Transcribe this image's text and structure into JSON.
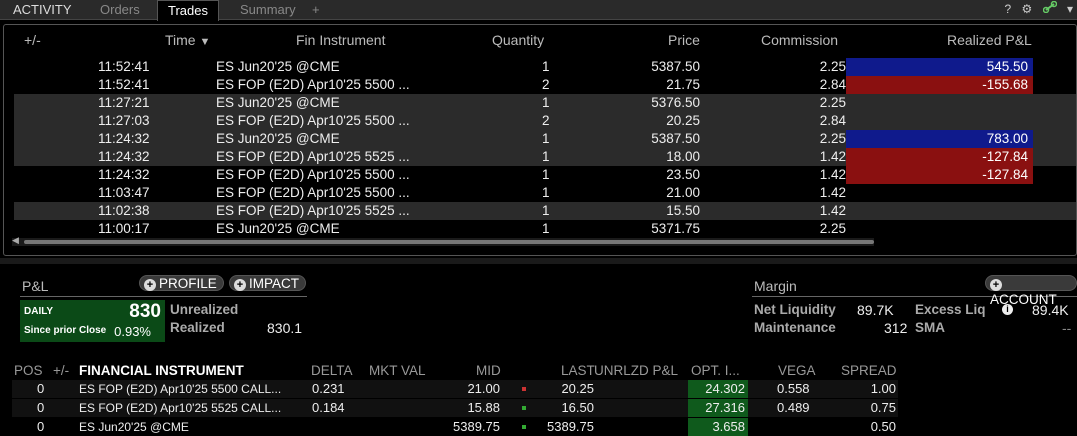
{
  "tabs": {
    "activity": "ACTIVITY",
    "orders": "Orders",
    "trades": "Trades",
    "summary": "Summary",
    "add": "+"
  },
  "toolbar": {
    "help": "?",
    "gear": "⚙",
    "link": "🔗",
    "menu": "▾"
  },
  "trades_table": {
    "headers": {
      "expand": "+/-",
      "time": "Time",
      "sort": "▼",
      "instrument": "Fin Instrument",
      "quantity": "Quantity",
      "price": "Price",
      "commission": "Commission",
      "realized": "Realized P&L"
    },
    "rows": [
      {
        "time": "11:52:41",
        "instrument": "ES Jun20'25 @CME",
        "quantity": "1",
        "price": "5387.50",
        "commission": "2.25",
        "realized": "545.50",
        "pnl_kind": "pos"
      },
      {
        "time": "11:52:41",
        "instrument": "ES FOP (E2D) Apr10'25 5500 ...",
        "quantity": "2",
        "price": "21.75",
        "commission": "2.84",
        "realized": "-155.68",
        "pnl_kind": "neg"
      },
      {
        "time": "11:27:21",
        "instrument": "ES Jun20'25 @CME",
        "quantity": "1",
        "price": "5376.50",
        "commission": "2.25",
        "realized": "",
        "pnl_kind": "none"
      },
      {
        "time": "11:27:03",
        "instrument": "ES FOP (E2D) Apr10'25 5500 ...",
        "quantity": "2",
        "price": "20.25",
        "commission": "2.84",
        "realized": "",
        "pnl_kind": "none"
      },
      {
        "time": "11:24:32",
        "instrument": "ES Jun20'25 @CME",
        "quantity": "1",
        "price": "5387.50",
        "commission": "2.25",
        "realized": "783.00",
        "pnl_kind": "pos"
      },
      {
        "time": "11:24:32",
        "instrument": "ES FOP (E2D) Apr10'25 5525 ...",
        "quantity": "1",
        "price": "18.00",
        "commission": "1.42",
        "realized": "-127.84",
        "pnl_kind": "neg"
      },
      {
        "time": "11:24:32",
        "instrument": "ES FOP (E2D) Apr10'25 5500 ...",
        "quantity": "1",
        "price": "23.50",
        "commission": "1.42",
        "realized": "-127.84",
        "pnl_kind": "neg"
      },
      {
        "time": "11:03:47",
        "instrument": "ES FOP (E2D) Apr10'25 5500 ...",
        "quantity": "1",
        "price": "21.00",
        "commission": "1.42",
        "realized": "",
        "pnl_kind": "none"
      },
      {
        "time": "11:02:38",
        "instrument": "ES FOP (E2D) Apr10'25 5525 ...",
        "quantity": "1",
        "price": "15.50",
        "commission": "1.42",
        "realized": "",
        "pnl_kind": "none"
      },
      {
        "time": "11:00:17",
        "instrument": "ES Jun20'25 @CME",
        "quantity": "1",
        "price": "5371.75",
        "commission": "2.25",
        "realized": "",
        "pnl_kind": "none"
      }
    ]
  },
  "pnl": {
    "title": "P&L",
    "profile_btn": "PROFILE",
    "impact_btn": "IMPACT",
    "daily_label": "DAILY",
    "daily_value": "830",
    "since_label": "Since prior Close",
    "since_pct": "0.93%",
    "unrealized_label": "Unrealized",
    "realized_label": "Realized",
    "realized_value": "830.1"
  },
  "margin": {
    "title": "Margin",
    "account_btn": "ACCOUNT",
    "net_liq_label": "Net Liquidity",
    "net_liq_value": "89.7K",
    "excess_label": "Excess Liq",
    "excess_value": "89.4K",
    "maint_label": "Maintenance",
    "maint_value": "312",
    "sma_label": "SMA",
    "sma_value": "--"
  },
  "positions": {
    "headers": {
      "pos": "POS",
      "expand": "+/-",
      "instrument": "FINANCIAL INSTRUMENT",
      "delta": "DELTA",
      "mktval": "MKT VAL",
      "mid": "MID",
      "last": "LAST",
      "unrlzd": "UNRLZD P&L",
      "opt": "OPT. I...",
      "vega": "VEGA",
      "spread": "SPREAD"
    },
    "rows": [
      {
        "pos": "0",
        "instrument": "ES FOP (E2D) Apr10'25 5500 CALL...",
        "delta": "0.231",
        "mid": "21.00",
        "last": "20.25",
        "tick": "red",
        "opt": "24.302",
        "vega": "0.558",
        "spread": "1.00"
      },
      {
        "pos": "0",
        "instrument": "ES FOP (E2D) Apr10'25 5525 CALL...",
        "delta": "0.184",
        "mid": "15.88",
        "last": "16.50",
        "tick": "green",
        "opt": "27.316",
        "vega": "0.489",
        "spread": "0.75"
      },
      {
        "pos": "0",
        "instrument": "ES Jun20'25 @CME",
        "delta": "",
        "mid": "5389.75",
        "last": "5389.75",
        "tick": "green",
        "opt": "3.658",
        "vega": "",
        "spread": "0.50"
      }
    ]
  },
  "colors": {
    "positive_pnl": "#0f1a8c",
    "negative_pnl": "#8a1010",
    "daily_box": "#0b4a17",
    "opt_cell": "#0f5a1c"
  }
}
